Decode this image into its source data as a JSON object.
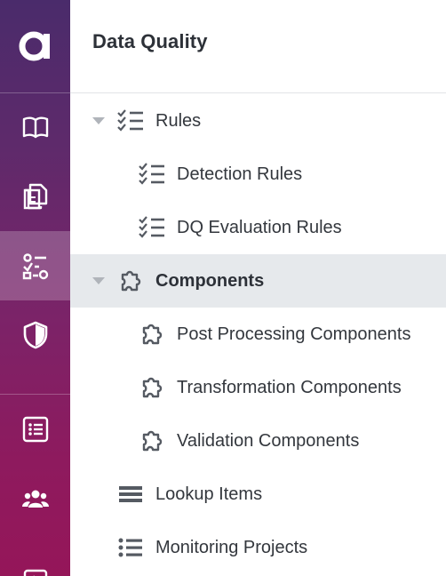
{
  "header": {
    "title": "Data Quality"
  },
  "nav": {
    "logo_icon": "ataccama-logo",
    "items": [
      {
        "icon": "book-icon",
        "active": false
      },
      {
        "icon": "documents-icon",
        "active": false
      },
      {
        "icon": "rules-icon",
        "active": true
      },
      {
        "icon": "shield-icon",
        "active": false
      },
      {
        "icon": "list-icon",
        "active": false
      },
      {
        "icon": "users-icon",
        "active": false
      },
      {
        "icon": "monitor-icon",
        "active": false
      }
    ]
  },
  "tree": {
    "rules": {
      "label": "Rules",
      "expanded": true,
      "icon": "checklist-icon",
      "children": [
        {
          "label": "Detection Rules",
          "icon": "checklist-icon"
        },
        {
          "label": "DQ Evaluation Rules",
          "icon": "checklist-icon"
        }
      ]
    },
    "components": {
      "label": "Components",
      "expanded": true,
      "selected": true,
      "icon": "puzzle-icon",
      "children": [
        {
          "label": "Post Processing Components",
          "icon": "puzzle-icon"
        },
        {
          "label": "Transformation Components",
          "icon": "puzzle-icon"
        },
        {
          "label": "Validation Components",
          "icon": "puzzle-icon"
        }
      ]
    },
    "lookup_items": {
      "label": "Lookup Items",
      "icon": "lines-icon"
    },
    "monitoring_projects": {
      "label": "Monitoring Projects",
      "icon": "bullet-list-icon"
    }
  },
  "colors": {
    "rail_top": "#4a2b6b",
    "rail_bottom": "#951659",
    "selected_row": "#e6e9ec",
    "text": "#33373d",
    "icon": "#555a62"
  }
}
